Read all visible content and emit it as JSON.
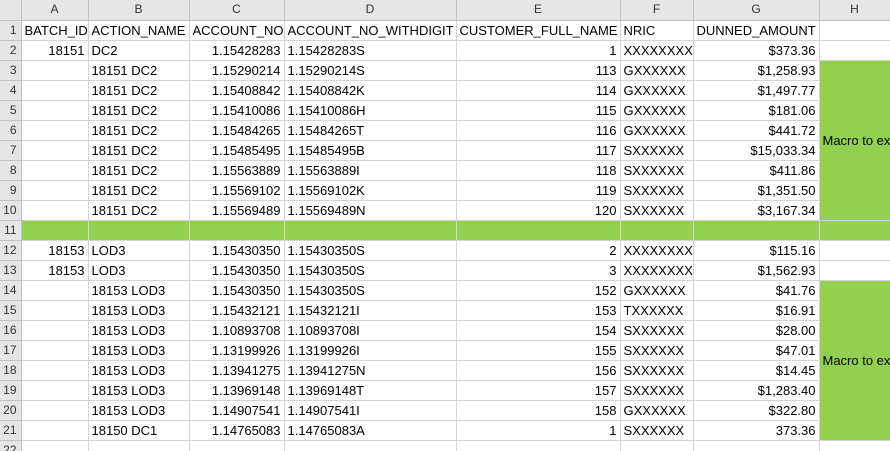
{
  "columns": [
    "A",
    "B",
    "C",
    "D",
    "E",
    "F",
    "G",
    "H"
  ],
  "header": [
    "BATCH_ID",
    "ACTION_NAME",
    "ACCOUNT_NO",
    "ACCOUNT_NO_WITHDIGIT",
    "CUSTOMER_FULL_NAME",
    "NRIC",
    "DUNNED_AMOUNT",
    ""
  ],
  "rows": [
    [
      "18151",
      "DC2",
      "1.15428283",
      "1.15428283S",
      "1",
      "XXXXXXXXXX",
      "$373.36",
      ""
    ],
    [
      "",
      "18151 DC2",
      "1.15290214",
      "1.15290214S",
      "113",
      "GXXXXXX",
      "$1,258.93",
      ""
    ],
    [
      "",
      "18151 DC2",
      "1.15408842",
      "1.15408842K",
      "114",
      "GXXXXXX",
      "$1,497.77",
      ""
    ],
    [
      "",
      "18151 DC2",
      "1.15410086",
      "1.15410086H",
      "115",
      "GXXXXXX",
      "$181.06",
      ""
    ],
    [
      "",
      "18151 DC2",
      "1.15484265",
      "1.15484265T",
      "116",
      "GXXXXXX",
      "$441.72",
      ""
    ],
    [
      "",
      "18151 DC2",
      "1.15485495",
      "1.15485495B",
      "117",
      "SXXXXXX",
      "$15,033.34",
      ""
    ],
    [
      "",
      "18151 DC2",
      "1.15563889",
      "1.15563889I",
      "118",
      "SXXXXXX",
      "$411.86",
      ""
    ],
    [
      "",
      "18151 DC2",
      "1.15569102",
      "1.15569102K",
      "119",
      "SXXXXXX",
      "$1,351.50",
      ""
    ],
    [
      "",
      "18151 DC2",
      "1.15569489",
      "1.15569489N",
      "120",
      "SXXXXXX",
      "$3,167.34",
      ""
    ],
    [
      "",
      "",
      "",
      "",
      "",
      "",
      "",
      ""
    ],
    [
      "18153",
      "LOD3",
      "1.15430350",
      "1.15430350S",
      "2",
      "XXXXXXXXXX",
      "$115.16",
      ""
    ],
    [
      "18153",
      "LOD3",
      "1.15430350",
      "1.15430350S",
      "3",
      "XXXXXXXXXX",
      "$1,562.93",
      ""
    ],
    [
      "",
      "18153 LOD3",
      "1.15430350",
      "1.15430350S",
      "152",
      "GXXXXXX",
      "$41.76",
      ""
    ],
    [
      "",
      "18153 LOD3",
      "1.15432121",
      "1.15432121I",
      "153",
      "TXXXXXX",
      "$16.91",
      ""
    ],
    [
      "",
      "18153 LOD3",
      "1.10893708",
      "1.10893708I",
      "154",
      "SXXXXXX",
      "$28.00",
      ""
    ],
    [
      "",
      "18153 LOD3",
      "1.13199926",
      "1.13199926I",
      "155",
      "SXXXXXX",
      "$47.01",
      ""
    ],
    [
      "",
      "18153 LOD3",
      "1.13941275",
      "1.13941275N",
      "156",
      "SXXXXXX",
      "$14.45",
      ""
    ],
    [
      "",
      "18153 LOD3",
      "1.13969148",
      "1.13969148T",
      "157",
      "SXXXXXX",
      "$1,283.40",
      ""
    ],
    [
      "",
      "18153 LOD3",
      "1.14907541",
      "1.14907541I",
      "158",
      "GXXXXXX",
      "$322.80",
      ""
    ],
    [
      "",
      "18150 DC1",
      "1.14765083",
      "1.14765083A",
      "1",
      "SXXXXXX",
      "373.36",
      ""
    ]
  ],
  "macro_note_1": "Macro to execute the copy and paste",
  "macro_note_2": "Macro to execute the copy and paste",
  "extra_row_number": "22",
  "colors": {
    "highlight": "#92d050",
    "header_bg": "#e6e6e6",
    "gridline": "#d4d4d4"
  }
}
